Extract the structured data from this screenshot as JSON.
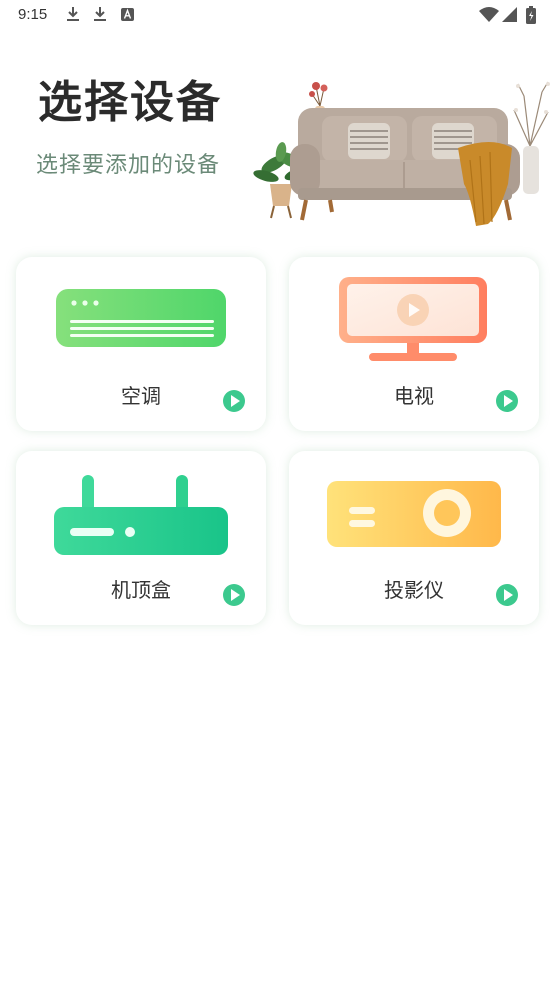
{
  "status_bar": {
    "time": "9:15",
    "icons": [
      "download-icon",
      "download-icon",
      "a-notification-icon",
      "wifi-icon",
      "signal-icon",
      "battery-icon"
    ]
  },
  "header": {
    "title": "选择设备",
    "subtitle": "选择要添加的设备"
  },
  "devices": [
    {
      "label": "空调",
      "icon": "air-conditioner-icon",
      "color": "#4cd964"
    },
    {
      "label": "电视",
      "icon": "tv-icon",
      "color": "#ff8a65"
    },
    {
      "label": "机顶盒",
      "icon": "set-top-box-icon",
      "color": "#2ecc8f"
    },
    {
      "label": "投影仪",
      "icon": "projector-icon",
      "color": "#ffc04d"
    }
  ],
  "colors": {
    "accent": "#3cc98e",
    "subtitle": "#6b8a78"
  }
}
